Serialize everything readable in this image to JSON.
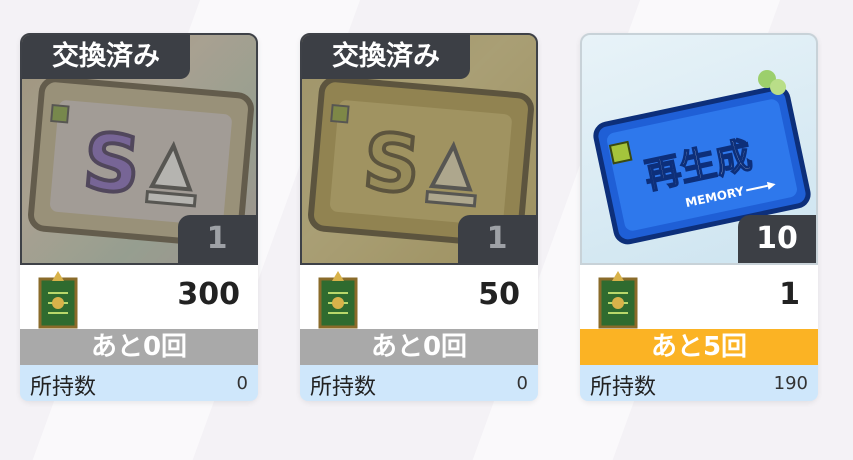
{
  "items": [
    {
      "exchanged_label": "交換済み",
      "quantity": "1",
      "price": "300",
      "remaining": "あと0回",
      "owned_label": "所持数",
      "owned_value": "0"
    },
    {
      "exchanged_label": "交換済み",
      "quantity": "1",
      "price": "50",
      "remaining": "あと0回",
      "owned_label": "所持数",
      "owned_value": "0"
    },
    {
      "ticket_title": "再生成",
      "ticket_subtitle": "MEMORY",
      "quantity": "10",
      "price": "1",
      "remaining": "あと5回",
      "owned_label": "所持数",
      "owned_value": "190"
    }
  ],
  "colors": {
    "exchanged_banner": "#3c3f45",
    "remain_soldout": "#a9a9a9",
    "remain_available": "#fbb324",
    "owned_bar": "#cfe7fb",
    "memory_ticket": "#1f5fd6"
  }
}
